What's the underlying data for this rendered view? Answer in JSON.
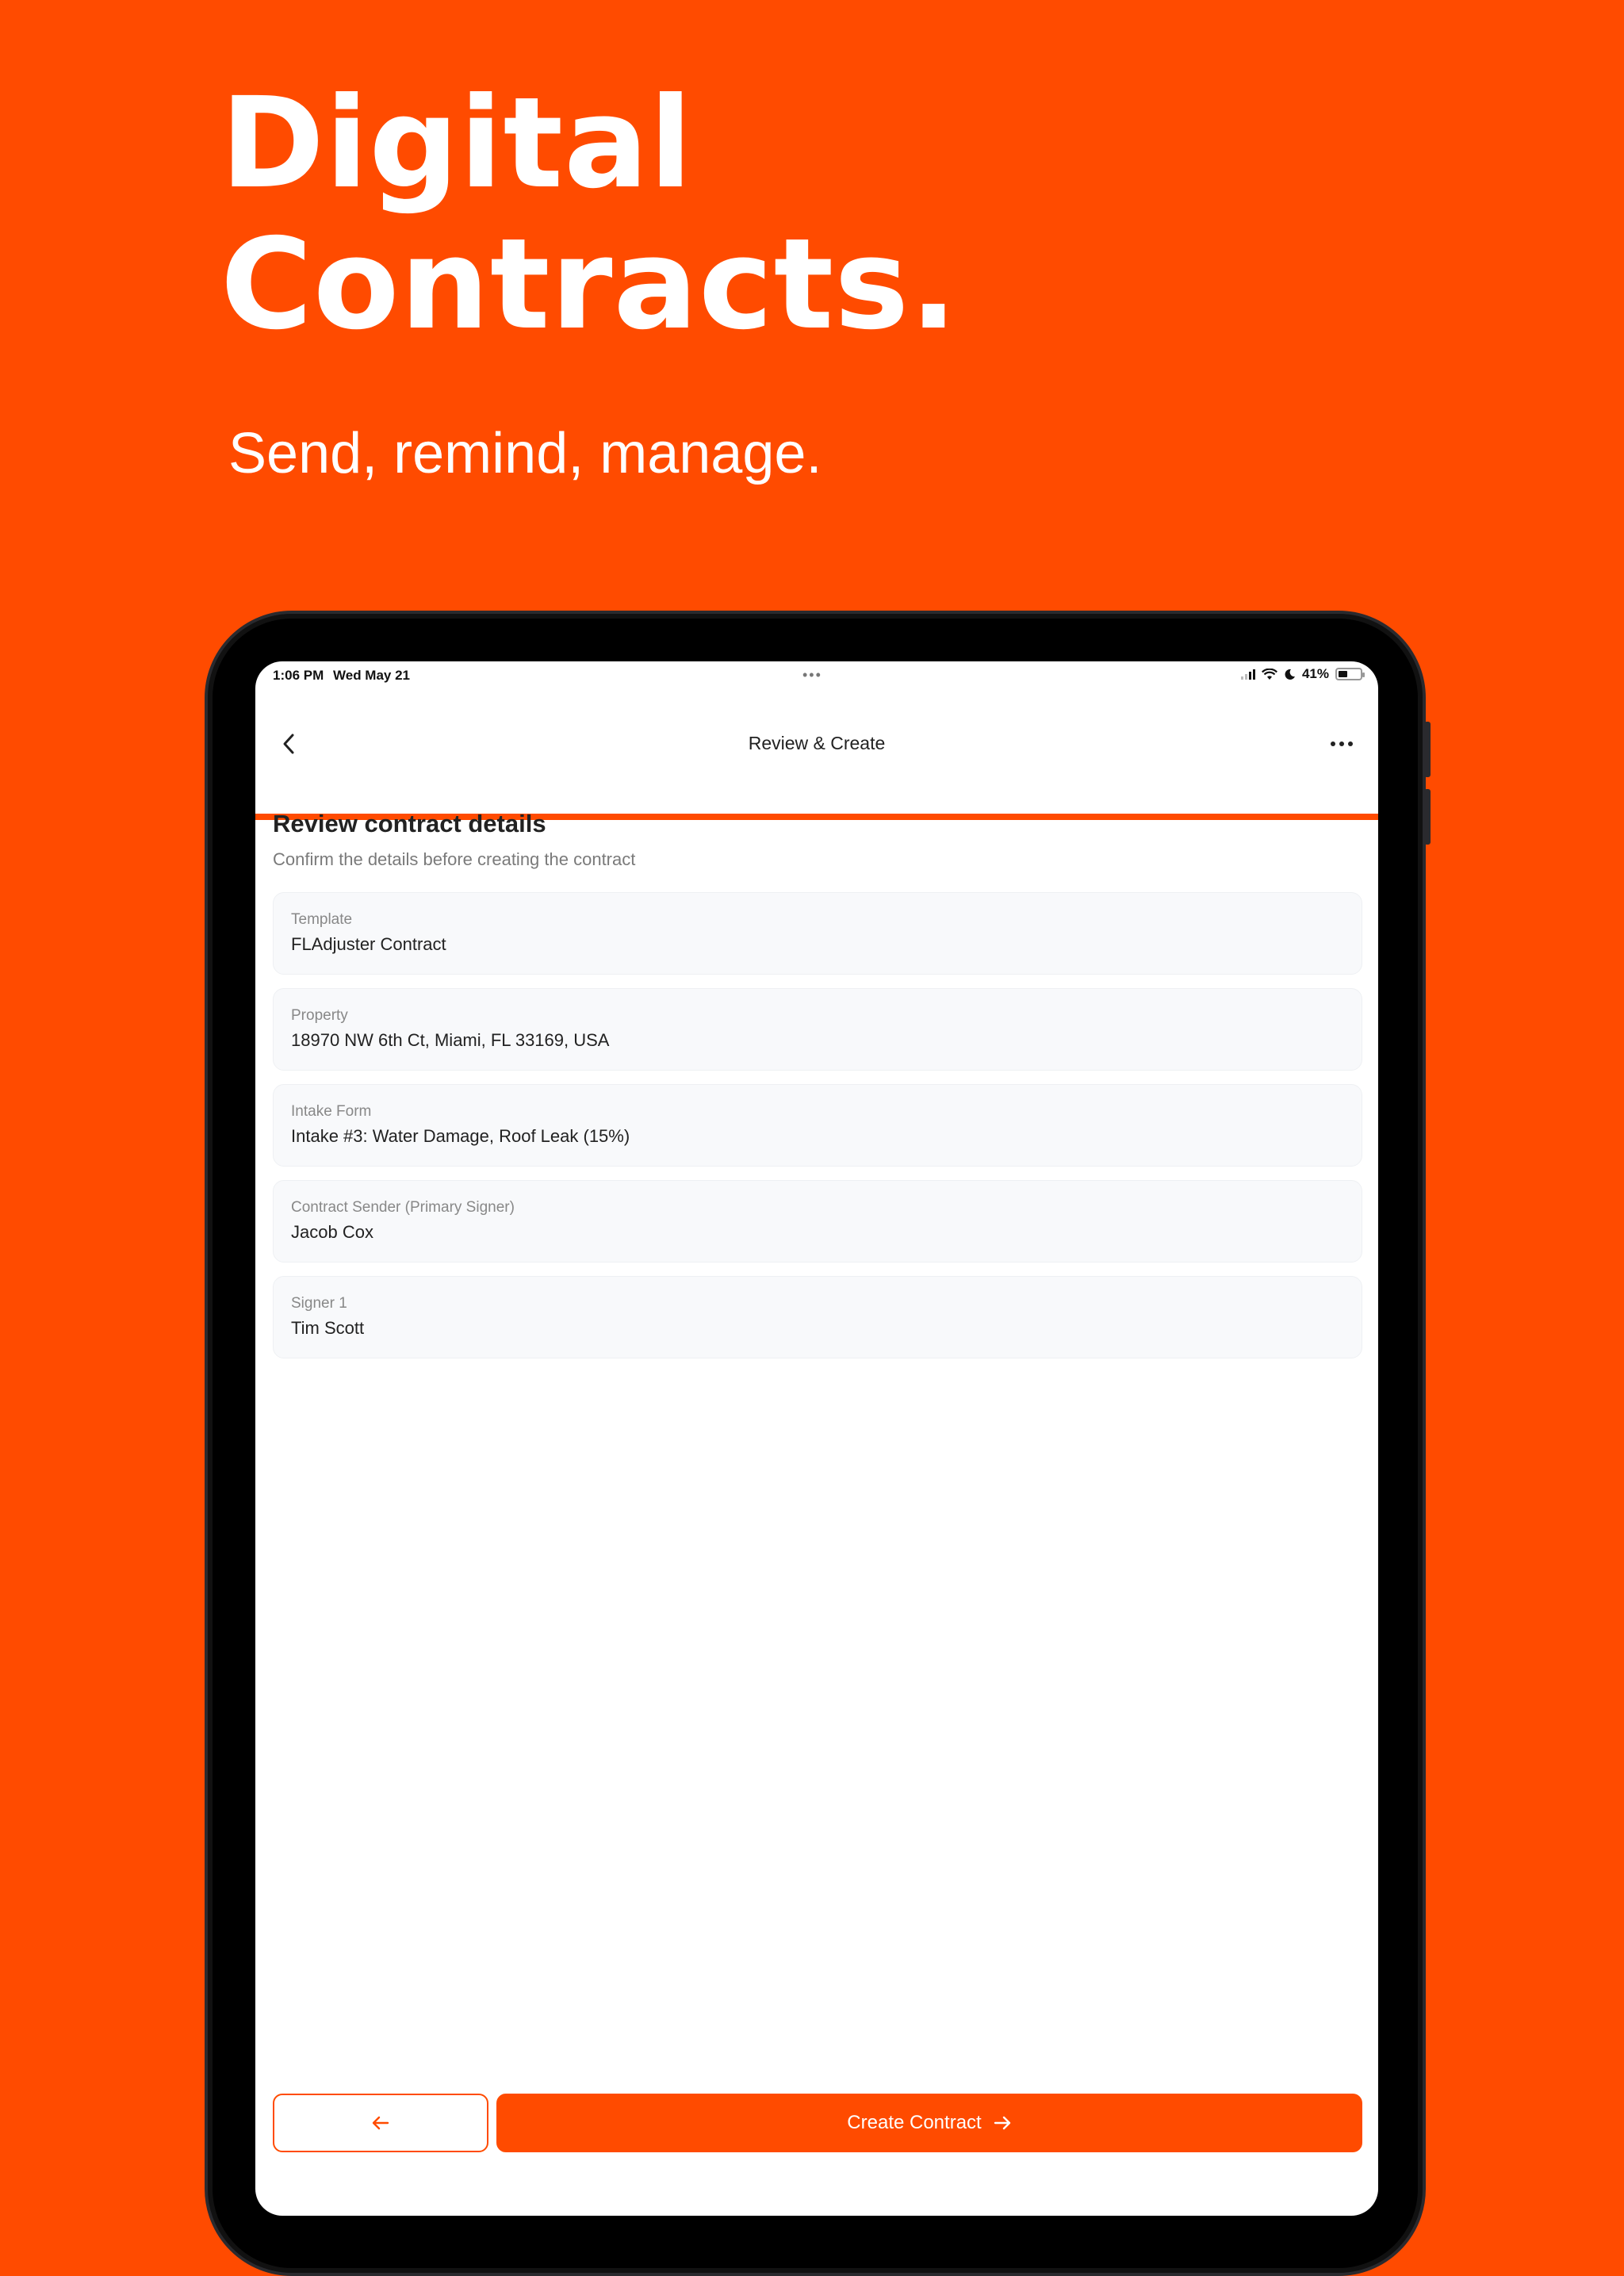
{
  "hero": {
    "headline_line1": "Digital",
    "headline_line2": "Contracts.",
    "tagline": "Send, remind, manage."
  },
  "status_bar": {
    "time": "1:06 PM",
    "date": "Wed May 21",
    "battery": "41%",
    "battery_level": 0.41
  },
  "nav": {
    "back_icon": "chevron-left-icon",
    "title": "Review & Create",
    "more_icon": "more-horizontal-icon",
    "progress": 1.0
  },
  "review": {
    "title": "Review contract details",
    "subtitle": "Confirm the details before creating the contract",
    "fields": [
      {
        "label": "Template",
        "value": "FLAdjuster Contract"
      },
      {
        "label": "Property",
        "value": "18970 NW 6th Ct, Miami, FL 33169, USA"
      },
      {
        "label": "Intake Form",
        "value": "Intake #3: Water Damage, Roof Leak (15%)"
      },
      {
        "label": "Contract Sender (Primary Signer)",
        "value": "Jacob Cox"
      },
      {
        "label": "Signer 1",
        "value": "Tim Scott"
      }
    ]
  },
  "actions": {
    "back_icon": "arrow-left-icon",
    "create_label": "Create Contract",
    "create_icon": "arrow-right-icon"
  },
  "colors": {
    "brand": "#FF4B00",
    "card_background": "#F8F9FB",
    "text_primary": "#222222",
    "text_secondary": "#7A7A7A"
  }
}
